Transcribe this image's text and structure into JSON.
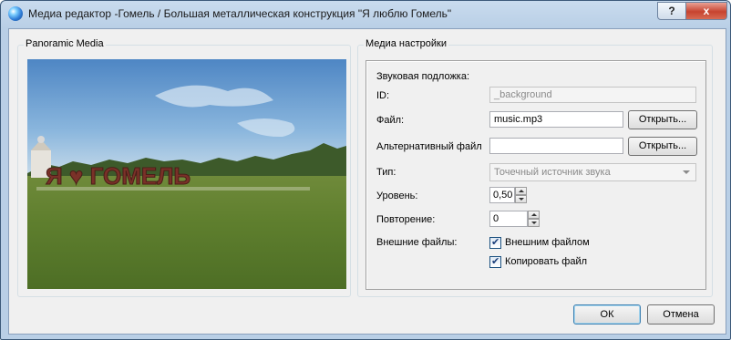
{
  "window": {
    "title": "Медиа редактор -Гомель / Большая металлическая конструкция \"Я люблю Гомель\"",
    "help_label": "?",
    "close_label": "x"
  },
  "left_panel": {
    "title": "Panoramic Media",
    "image_text": "Я ♥ ГОМЕЛЬ"
  },
  "settings": {
    "title": "Медиа настройки",
    "sound_section_label": "Звуковая подложка:",
    "id_label": "ID:",
    "id_value": "_background",
    "file_label": "Файл:",
    "file_value": "music.mp3",
    "file_open_button": "Открыть...",
    "alt_file_label": "Альтернативный файл",
    "alt_file_value": "",
    "alt_open_button": "Открыть...",
    "type_label": "Тип:",
    "type_value": "Точечный источник звука",
    "level_label": "Уровень:",
    "level_value": "0,50",
    "repeat_label": "Повторение:",
    "repeat_value": "0",
    "external_label": "Внешние файлы:",
    "external_checkbox_label": "Внешним файлом",
    "external_checked": true,
    "copy_checkbox_label": "Копировать файл",
    "copy_checked": true
  },
  "footer": {
    "ok_label": "ОК",
    "cancel_label": "Отмена"
  }
}
